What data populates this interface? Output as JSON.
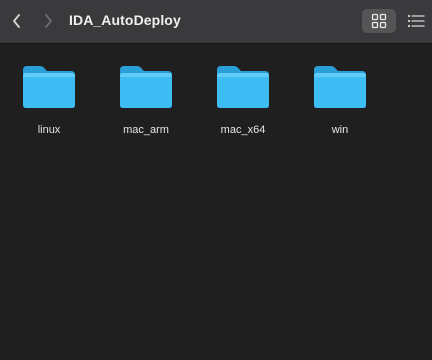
{
  "window": {
    "title": "IDA_AutoDeploy"
  },
  "toolbar": {
    "back_icon": "chevron-left-icon",
    "forward_icon": "chevron-right-icon",
    "grid_view_icon": "grid-icon",
    "list_view_icon": "list-icon",
    "active_view": "grid"
  },
  "folders": [
    {
      "name": "linux",
      "icon": "folder-icon"
    },
    {
      "name": "mac_arm",
      "icon": "folder-icon"
    },
    {
      "name": "mac_x64",
      "icon": "folder-icon"
    },
    {
      "name": "win",
      "icon": "folder-icon"
    }
  ],
  "colors": {
    "background": "#1f1f20",
    "toolbar": "#3a3a3c",
    "folder_body": "#3ebdf4",
    "folder_tab": "#2a9fd8",
    "text": "#e6e6e6"
  }
}
